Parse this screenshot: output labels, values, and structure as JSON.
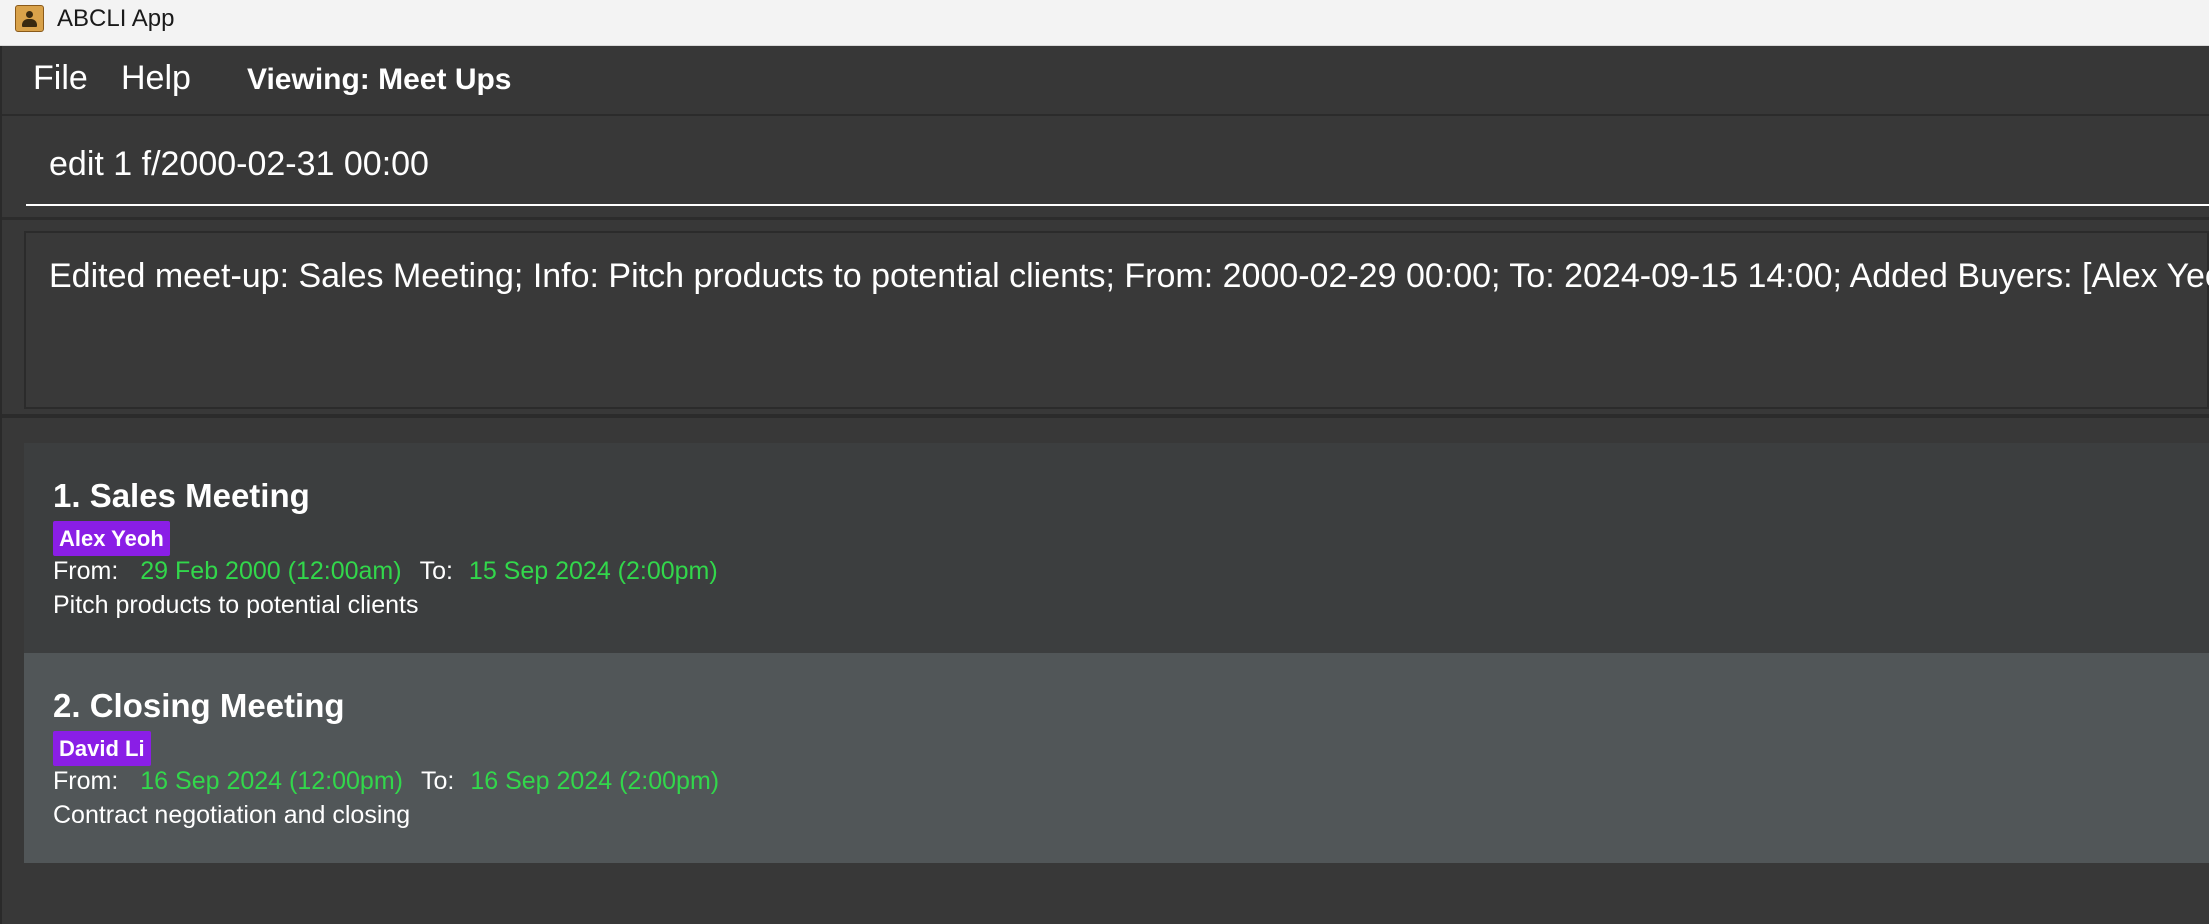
{
  "window": {
    "title": "ABCLI App",
    "icon": "person-icon"
  },
  "menubar": {
    "file_label": "File",
    "help_label": "Help",
    "viewing_label": "Viewing: Meet Ups"
  },
  "command": {
    "value": "edit 1 f/2000-02-31 00:00"
  },
  "result": {
    "text": "Edited meet-up: Sales Meeting; Info: Pitch products to potential clients; From: 2000-02-29 00:00; To: 2024-09-15 14:00; Added Buyers: [Alex Yeoh]"
  },
  "meetups": [
    {
      "title": "1. Sales Meeting",
      "buyer": "Alex Yeoh",
      "from_label": "From:",
      "from": "29 Feb 2000 (12:00am)",
      "to_label": "To:",
      "to": "15 Sep 2024 (2:00pm)",
      "info": "Pitch products to potential clients"
    },
    {
      "title": "2. Closing Meeting",
      "buyer": "David Li",
      "from_label": "From:",
      "from": "16 Sep 2024 (12:00pm)",
      "to_label": "To:",
      "to": "16 Sep 2024 (2:00pm)",
      "info": "Contract negotiation and closing"
    }
  ],
  "colors": {
    "background": "#383838",
    "card_odd": "#3c3e3f",
    "card_even": "#515658",
    "tag": "#8a1ee6",
    "datetime": "#32d74b"
  }
}
